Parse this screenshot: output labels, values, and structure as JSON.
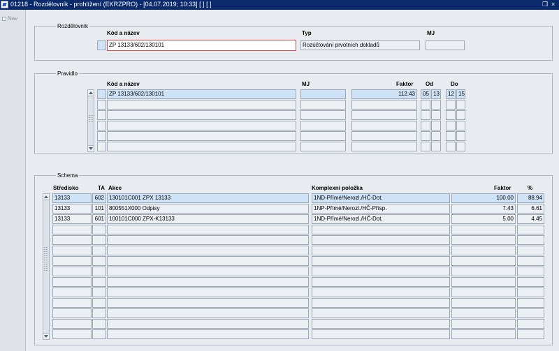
{
  "window": {
    "title": "01218 - Rozdělovník - prohlížení (EKRZPRO) - [04.07.2019; 10:33]  [ ]  [ ]",
    "restore_glyph": "❐",
    "close_glyph": "×"
  },
  "nav": {
    "label": "Nav"
  },
  "rozdelovnik": {
    "legend": "Rozdělovník",
    "headers": {
      "kod": "Kód a název",
      "typ": "Typ",
      "mj": "MJ"
    },
    "kod_value": "ZP 13133/602/130101",
    "typ_value": "Rozúčtování prvotních dokladů",
    "mj_value": ""
  },
  "pravidlo": {
    "legend": "Pravidlo",
    "headers": {
      "kod": "Kód a název",
      "mj": "MJ",
      "faktor": "Faktor",
      "od": "Od",
      "do": "Do"
    },
    "rows": [
      {
        "kod": "ZP 13133/602/130101",
        "mj": "",
        "faktor": "112.43",
        "od1": "05",
        "od2": "13",
        "do1": "12",
        "do2": "15"
      },
      {
        "kod": "",
        "mj": "",
        "faktor": "",
        "od1": "",
        "od2": "",
        "do1": "",
        "do2": ""
      },
      {
        "kod": "",
        "mj": "",
        "faktor": "",
        "od1": "",
        "od2": "",
        "do1": "",
        "do2": ""
      },
      {
        "kod": "",
        "mj": "",
        "faktor": "",
        "od1": "",
        "od2": "",
        "do1": "",
        "do2": ""
      },
      {
        "kod": "",
        "mj": "",
        "faktor": "",
        "od1": "",
        "od2": "",
        "do1": "",
        "do2": ""
      },
      {
        "kod": "",
        "mj": "",
        "faktor": "",
        "od1": "",
        "od2": "",
        "do1": "",
        "do2": ""
      }
    ]
  },
  "schema": {
    "legend": "Schema",
    "headers": {
      "stredisko": "Středisko",
      "ta": "TA",
      "akce": "Akce",
      "polozka": "Komplexní položka",
      "faktor": "Faktor",
      "pct": "%"
    },
    "rows": [
      {
        "stredisko": "13133",
        "ta": "602",
        "akce": "130101C001 ZPX 13133",
        "polozka": "1ND-Přímé/Nerozl./HČ-Dot.",
        "faktor": "100.00",
        "pct": "88.94"
      },
      {
        "stredisko": "13133",
        "ta": "101",
        "akce": "800551X000 Odpisy",
        "polozka": "1NP-Přímé/Nerozl./HČ-Přísp.",
        "faktor": "7.43",
        "pct": "6.61"
      },
      {
        "stredisko": "13133",
        "ta": "601",
        "akce": "100101C000 ZPX-K13133",
        "polozka": "1ND-Přímé/Nerozl./HČ-Dot.",
        "faktor": "5.00",
        "pct": "4.45"
      },
      {
        "stredisko": "",
        "ta": "",
        "akce": "",
        "polozka": "",
        "faktor": "",
        "pct": ""
      },
      {
        "stredisko": "",
        "ta": "",
        "akce": "",
        "polozka": "",
        "faktor": "",
        "pct": ""
      },
      {
        "stredisko": "",
        "ta": "",
        "akce": "",
        "polozka": "",
        "faktor": "",
        "pct": ""
      },
      {
        "stredisko": "",
        "ta": "",
        "akce": "",
        "polozka": "",
        "faktor": "",
        "pct": ""
      },
      {
        "stredisko": "",
        "ta": "",
        "akce": "",
        "polozka": "",
        "faktor": "",
        "pct": ""
      },
      {
        "stredisko": "",
        "ta": "",
        "akce": "",
        "polozka": "",
        "faktor": "",
        "pct": ""
      },
      {
        "stredisko": "",
        "ta": "",
        "akce": "",
        "polozka": "",
        "faktor": "",
        "pct": ""
      },
      {
        "stredisko": "",
        "ta": "",
        "akce": "",
        "polozka": "",
        "faktor": "",
        "pct": ""
      },
      {
        "stredisko": "",
        "ta": "",
        "akce": "",
        "polozka": "",
        "faktor": "",
        "pct": ""
      },
      {
        "stredisko": "",
        "ta": "",
        "akce": "",
        "polozka": "",
        "faktor": "",
        "pct": ""
      },
      {
        "stredisko": "",
        "ta": "",
        "akce": "",
        "polozka": "",
        "faktor": "",
        "pct": ""
      }
    ]
  },
  "colors": {
    "titlebar": "#0a2a6b",
    "selected_row": "#cfe3f8",
    "focus_border": "#d05050"
  }
}
